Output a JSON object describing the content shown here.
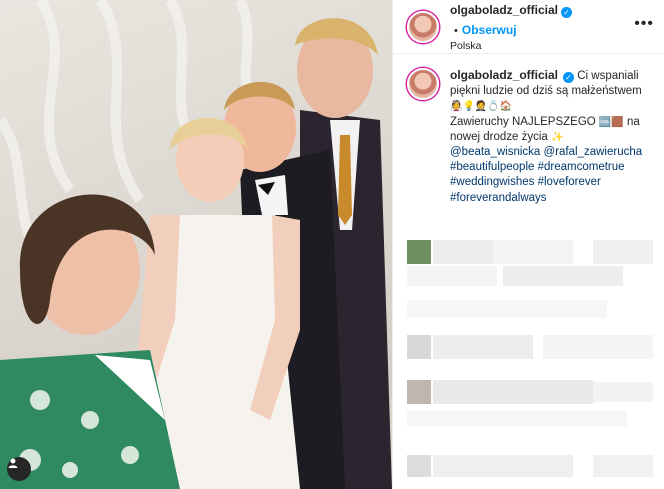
{
  "post": {
    "username": "olgaboladz_official",
    "follow_label": "Obserwuj",
    "location": "Polska",
    "more_label": "•••",
    "separator": "•"
  },
  "caption": {
    "username": "olgaboladz_official",
    "line1": "Ci wspaniali piękni ludzie od dziś są małżeństwem",
    "emoji1": "👰💡🤵💍🏠",
    "line2a": "Zawieruchy NAJLEPSZEGO",
    "emoji2": "🆒🟫",
    "line2b": "na nowej drodze życia",
    "emoji3": "✨",
    "mentions": [
      "@beata_wisnicka",
      "@rafal_zawierucha"
    ],
    "hashtags": [
      "#beautifulpeople",
      "#dreamcometrue",
      "#weddingwishes",
      "#loveforever",
      "#foreverandalways"
    ]
  },
  "colors": {
    "link": "#00376b",
    "accent": "#0095f6",
    "text": "#262626"
  },
  "icons": {
    "verified": "verified-badge-icon",
    "user_tag": "user-tag-icon"
  }
}
